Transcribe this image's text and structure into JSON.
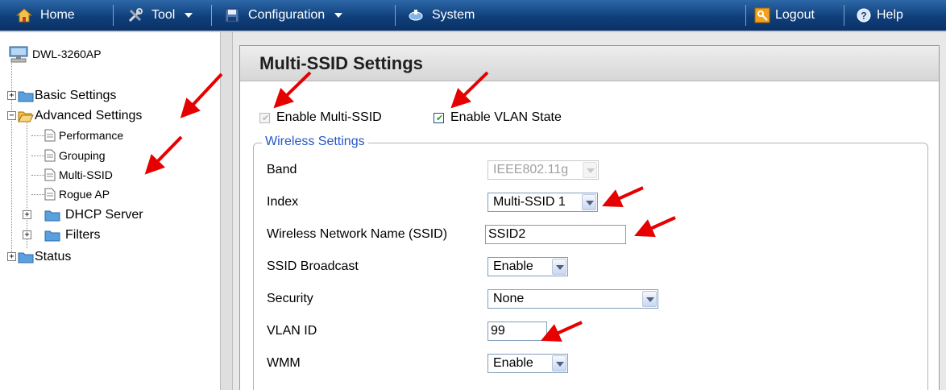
{
  "menubar": {
    "home": "Home",
    "tool": "Tool",
    "configuration": "Configuration",
    "system": "System",
    "logout": "Logout",
    "help": "Help"
  },
  "tree": {
    "root": "DWL-3260AP",
    "basic": "Basic Settings",
    "advanced": "Advanced Settings",
    "performance": "Performance",
    "grouping": "Grouping",
    "multissid": "Multi-SSID",
    "rogue": "Rogue AP",
    "dhcp": "DHCP Server",
    "filters": "Filters",
    "status": "Status"
  },
  "main": {
    "title": "Multi-SSID Settings",
    "enable_multi_ssid": {
      "label": "Enable Multi-SSID",
      "checked": true,
      "disabled": true
    },
    "enable_vlan": {
      "label": "Enable VLAN State",
      "checked": true
    },
    "wireless_legend": "Wireless Settings",
    "fields": {
      "band": {
        "label": "Band",
        "value": "IEEE802.11g"
      },
      "index": {
        "label": "Index",
        "value": "Multi-SSID 1"
      },
      "ssid": {
        "label": "Wireless Network Name (SSID)",
        "value": "SSID2"
      },
      "broadcast": {
        "label": "SSID Broadcast",
        "value": "Enable"
      },
      "security": {
        "label": "Security",
        "value": "None"
      },
      "vlan": {
        "label": "VLAN ID",
        "value": "99"
      },
      "wmm": {
        "label": "WMM",
        "value": "Enable"
      }
    }
  },
  "colors": {
    "menubar": "#0f3f7a",
    "legend": "#2658c9",
    "annotation_arrow": "#e60000"
  }
}
